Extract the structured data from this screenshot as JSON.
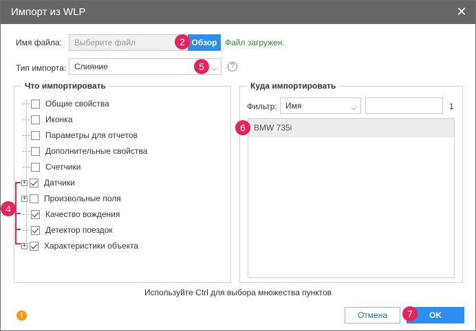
{
  "dialog": {
    "title": "Импорт из WLP"
  },
  "file": {
    "label": "Имя файла:",
    "placeholder": "Выберите файл",
    "browse_label": "Обзор",
    "status": "Файл загружен."
  },
  "import_type": {
    "label": "Тип импорта:",
    "value": "Слияние"
  },
  "what": {
    "legend": "Что импортировать",
    "items": [
      {
        "label": "Общие свойства",
        "checked": false,
        "expandable": false
      },
      {
        "label": "Иконка",
        "checked": false,
        "expandable": false
      },
      {
        "label": "Параметры для отчетов",
        "checked": false,
        "expandable": false
      },
      {
        "label": "Дополнительные свойства",
        "checked": false,
        "expandable": false
      },
      {
        "label": "Счетчики",
        "checked": false,
        "expandable": false
      },
      {
        "label": "Датчики",
        "checked": true,
        "expandable": true
      },
      {
        "label": "Произвольные поля",
        "checked": false,
        "expandable": true
      },
      {
        "label": "Качество вождения",
        "checked": true,
        "expandable": false
      },
      {
        "label": "Детектор поездок",
        "checked": true,
        "expandable": false
      },
      {
        "label": "Характеристики объекта",
        "checked": true,
        "expandable": true
      }
    ]
  },
  "where": {
    "legend": "Куда импортировать",
    "filter_label": "Фильтр:",
    "filter_field": "Имя",
    "count": "1",
    "items": [
      "BMW 735i"
    ]
  },
  "hint": "Используйте Ctrl для выбора множества пунктов",
  "footer": {
    "cancel_label": "Отмена",
    "ok_label": "OK"
  },
  "badges": [
    "2",
    "5",
    "4",
    "6",
    "7"
  ],
  "colors": {
    "accent": "#2d8ef0",
    "badge": "#e6245a",
    "success": "#2e8b2e",
    "warning": "#f39c12"
  }
}
